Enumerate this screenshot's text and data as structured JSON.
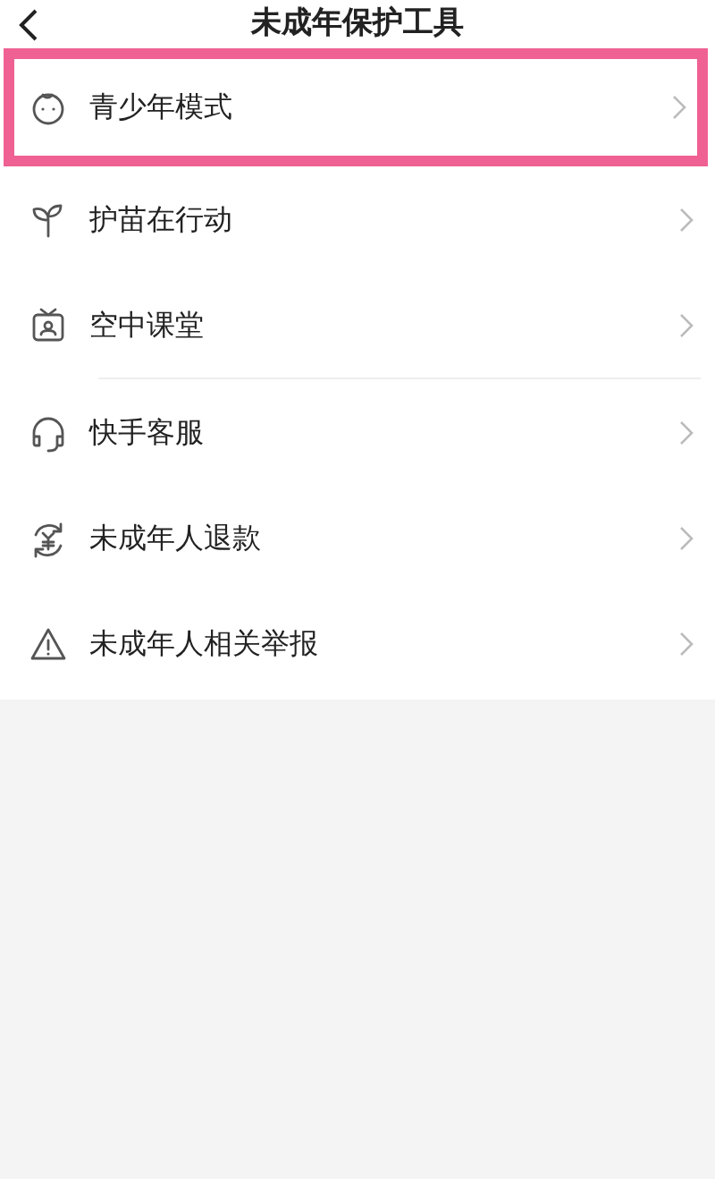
{
  "header": {
    "title": "未成年保护工具"
  },
  "items": [
    {
      "label": "青少年模式",
      "highlighted": true,
      "divider": false
    },
    {
      "label": "护苗在行动",
      "highlighted": false,
      "divider": false
    },
    {
      "label": "空中课堂",
      "highlighted": false,
      "divider": true
    },
    {
      "label": "快手客服",
      "highlighted": false,
      "divider": false
    },
    {
      "label": "未成年人退款",
      "highlighted": false,
      "divider": false
    },
    {
      "label": "未成年人相关举报",
      "highlighted": false,
      "divider": false
    }
  ]
}
